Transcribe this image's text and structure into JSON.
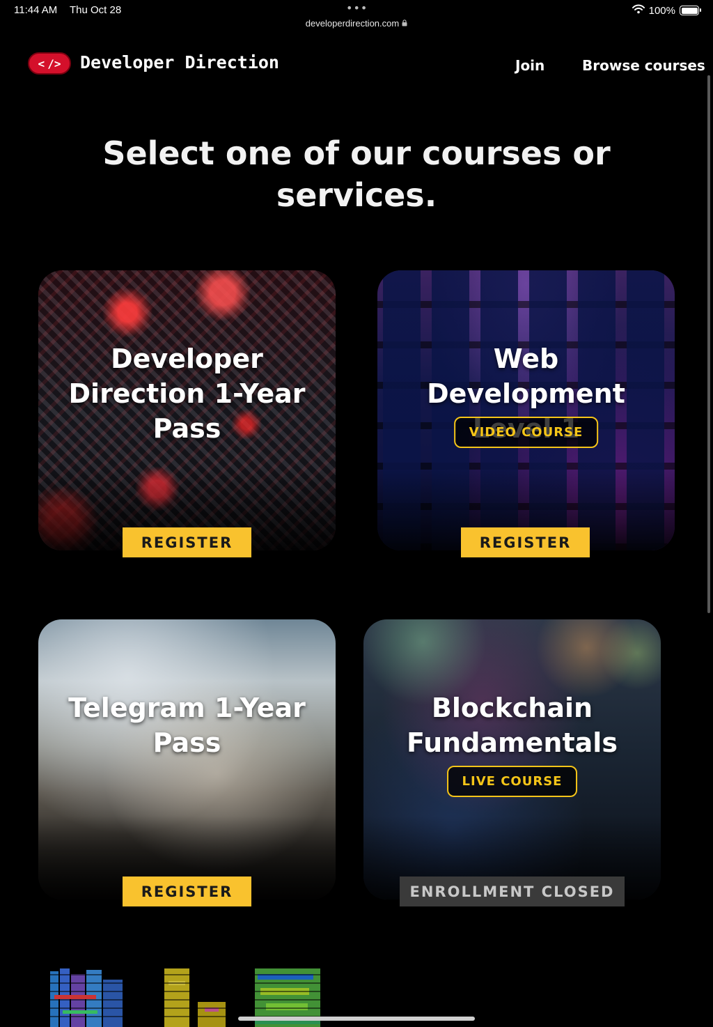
{
  "status_bar": {
    "time": "11:44 AM",
    "date": "Thu Oct 28",
    "url": "developerdirection.com",
    "battery": "100%",
    "battery_level": 1.0
  },
  "header": {
    "logo_left": "<",
    "logo_right": "/>",
    "site_name": "Developer Direction",
    "nav": {
      "join": "Join",
      "browse": "Browse courses"
    }
  },
  "heading": "Select one of our courses or services.",
  "cards": [
    {
      "title": "Developer Direction 1-Year Pass",
      "badge": "",
      "cta": "REGISTER",
      "cta_enabled": true
    },
    {
      "title": "Web Development Level 1",
      "badge": "VIDEO COURSE",
      "cta": "REGISTER",
      "cta_enabled": true
    },
    {
      "title": "Telegram 1-Year Pass",
      "badge": "",
      "cta": "REGISTER",
      "cta_enabled": true
    },
    {
      "title": "Blockchain Fundamentals",
      "badge": "LIVE COURSE",
      "cta": "ENROLLMENT CLOSED",
      "cta_enabled": false
    }
  ],
  "colors": {
    "accent_yellow": "#f9c22e",
    "badge_yellow": "#f5c518",
    "logo_red": "#d4102b",
    "disabled_gray": "#3a3a3a"
  },
  "icons": {
    "wifi": "wifi-icon",
    "battery": "battery-icon",
    "lock": "lock-icon",
    "logo": "code-brackets-icon"
  }
}
